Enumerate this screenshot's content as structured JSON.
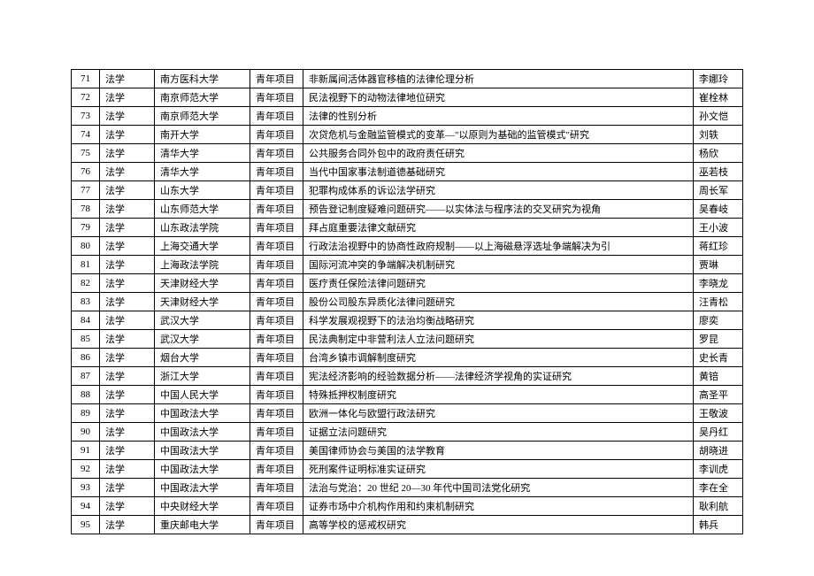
{
  "rows": [
    {
      "idx": "71",
      "field": "法学",
      "uni": "南方医科大学",
      "type": "青年项目",
      "title": "非新属间活体器官移植的法律伦理分析",
      "name": "李娜玲"
    },
    {
      "idx": "72",
      "field": "法学",
      "uni": "南京师范大学",
      "type": "青年项目",
      "title": "民法视野下的动物法律地位研究",
      "name": "崔栓林"
    },
    {
      "idx": "73",
      "field": "法学",
      "uni": "南京师范大学",
      "type": "青年项目",
      "title": "法律的性别分析",
      "name": "孙文恺"
    },
    {
      "idx": "74",
      "field": "法学",
      "uni": "南开大学",
      "type": "青年项目",
      "title": "次贷危机与金融监管模式的变革—\"以原则为基础的监管模式\"研究",
      "name": "刘轶"
    },
    {
      "idx": "75",
      "field": "法学",
      "uni": "清华大学",
      "type": "青年项目",
      "title": "公共服务合同外包中的政府责任研究",
      "name": "杨欣"
    },
    {
      "idx": "76",
      "field": "法学",
      "uni": "清华大学",
      "type": "青年项目",
      "title": "当代中国家事法制道德基础研究",
      "name": "巫若枝"
    },
    {
      "idx": "77",
      "field": "法学",
      "uni": "山东大学",
      "type": "青年项目",
      "title": "犯罪构成体系的诉讼法学研究",
      "name": "周长军"
    },
    {
      "idx": "78",
      "field": "法学",
      "uni": "山东师范大学",
      "type": "青年项目",
      "title": "预告登记制度疑难问题研究——以实体法与程序法的交叉研究为视角",
      "name": "吴春岐"
    },
    {
      "idx": "79",
      "field": "法学",
      "uni": "山东政法学院",
      "type": "青年项目",
      "title": "拜占庭重要法律文献研究",
      "name": "王小波"
    },
    {
      "idx": "80",
      "field": "法学",
      "uni": "上海交通大学",
      "type": "青年项目",
      "title": "行政法治视野中的协商性政府规制——以上海磁悬浮选址争端解决为引",
      "name": "蒋红珍"
    },
    {
      "idx": "81",
      "field": "法学",
      "uni": "上海政法学院",
      "type": "青年项目",
      "title": "国际河流冲突的争端解决机制研究",
      "name": "贾琳"
    },
    {
      "idx": "82",
      "field": "法学",
      "uni": "天津财经大学",
      "type": "青年项目",
      "title": "医疗责任保险法律问题研究",
      "name": "李晓龙"
    },
    {
      "idx": "83",
      "field": "法学",
      "uni": "天津财经大学",
      "type": "青年项目",
      "title": "股份公司股东异质化法律问题研究",
      "name": "汪青松"
    },
    {
      "idx": "84",
      "field": "法学",
      "uni": "武汉大学",
      "type": "青年项目",
      "title": "科学发展观视野下的法治均衡战略研究",
      "name": "廖奕"
    },
    {
      "idx": "85",
      "field": "法学",
      "uni": "武汉大学",
      "type": "青年项目",
      "title": "民法典制定中非营利法人立法问题研究",
      "name": "罗昆"
    },
    {
      "idx": "86",
      "field": "法学",
      "uni": "烟台大学",
      "type": "青年项目",
      "title": "台湾乡镇市调解制度研究",
      "name": "史长青"
    },
    {
      "idx": "87",
      "field": "法学",
      "uni": "浙江大学",
      "type": "青年项目",
      "title": "宪法经济影响的经验数据分析——法律经济学视角的实证研究",
      "name": "黄锫"
    },
    {
      "idx": "88",
      "field": "法学",
      "uni": "中国人民大学",
      "type": "青年项目",
      "title": "特殊抵押权制度研究",
      "name": "高圣平"
    },
    {
      "idx": "89",
      "field": "法学",
      "uni": "中国政法大学",
      "type": "青年项目",
      "title": "欧洲一体化与欧盟行政法研究",
      "name": "王敬波"
    },
    {
      "idx": "90",
      "field": "法学",
      "uni": "中国政法大学",
      "type": "青年项目",
      "title": "证据立法问题研究",
      "name": "吴丹红"
    },
    {
      "idx": "91",
      "field": "法学",
      "uni": "中国政法大学",
      "type": "青年项目",
      "title": "美国律师协会与美国的法学教育",
      "name": "胡晓进"
    },
    {
      "idx": "92",
      "field": "法学",
      "uni": "中国政法大学",
      "type": "青年项目",
      "title": "死刑案件证明标准实证研究",
      "name": "李训虎"
    },
    {
      "idx": "93",
      "field": "法学",
      "uni": "中国政法大学",
      "type": "青年项目",
      "title": "法治与党治：20 世纪 20—30 年代中国司法党化研究",
      "name": "李在全"
    },
    {
      "idx": "94",
      "field": "法学",
      "uni": "中央财经大学",
      "type": "青年项目",
      "title": "证券市场中介机构作用和约束机制研究",
      "name": "耿利航"
    },
    {
      "idx": "95",
      "field": "法学",
      "uni": "重庆邮电大学",
      "type": "青年项目",
      "title": "高等学校的惩戒权研究",
      "name": "韩兵"
    }
  ]
}
